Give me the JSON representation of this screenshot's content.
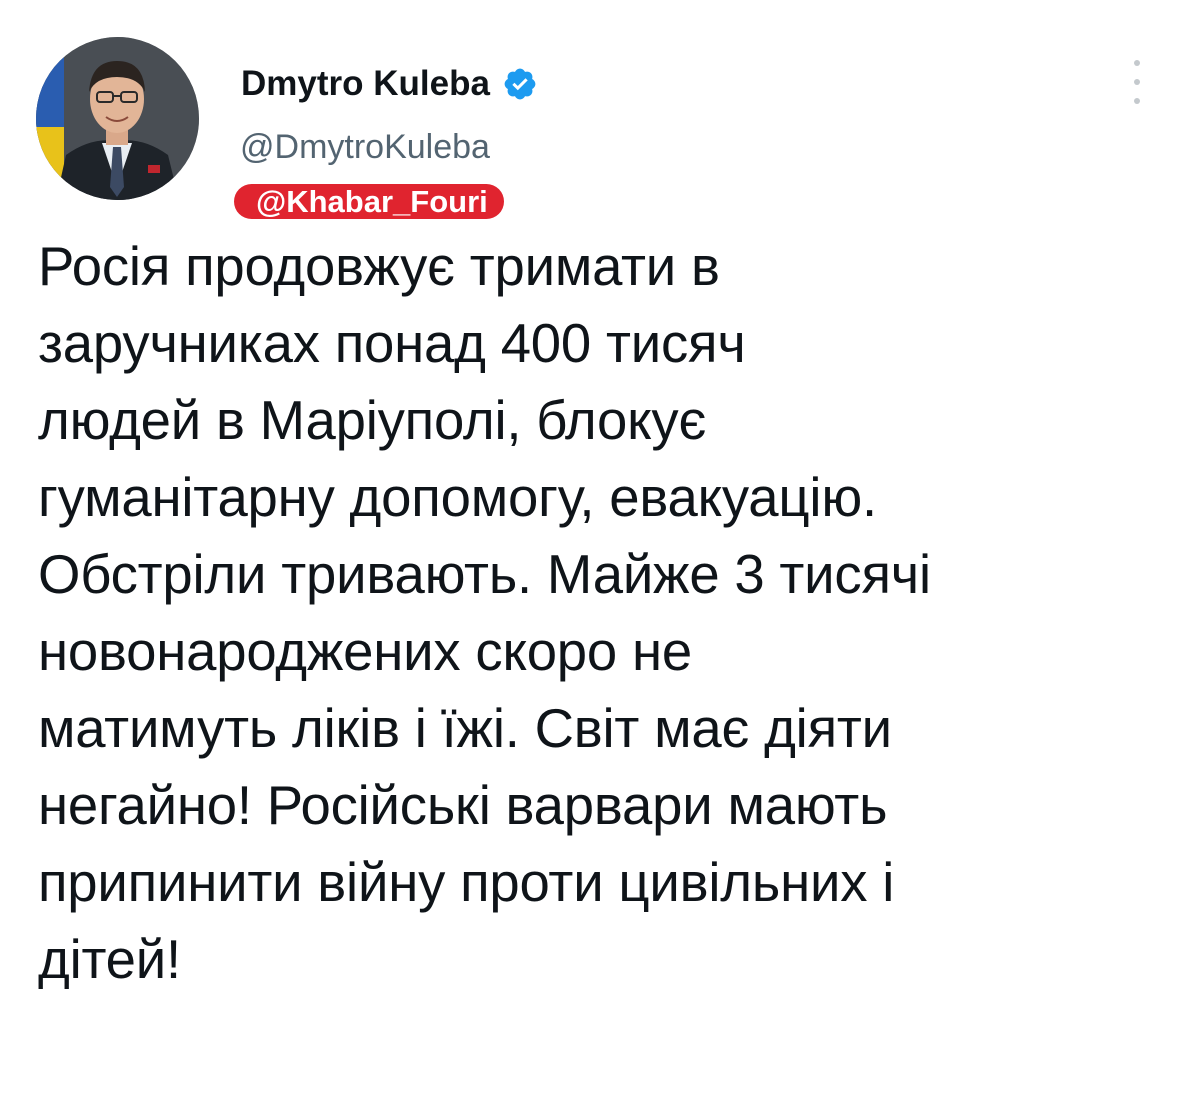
{
  "tweet": {
    "author": {
      "display_name": "Dmytro Kuleba",
      "handle": "@DmytroKuleba",
      "verified": true,
      "verified_icon": "verified-badge-icon",
      "avatar": "avatar-photo"
    },
    "watermark": "@Khabar_Fouri",
    "more_icon": "more-vertical-icon",
    "text": "Росія продовжує тримати в\nзаручниках понад 400 тисяч\nлюдей в Маріуполі, блокує\nгуманітарну допомогу, евакуацію.\nОбстріли тривають. Майже 3 тисячі\nновонароджених скоро не\nматимуть ліків і їжі. Світ має діяти\nнегайно! Російські варвари мають\nприпинити війну проти цивільних і\nдітей!"
  },
  "colors": {
    "text": "#0f1419",
    "secondary_text": "#536471",
    "verified": "#1d9bf0",
    "watermark_bg": "#e0242f"
  }
}
